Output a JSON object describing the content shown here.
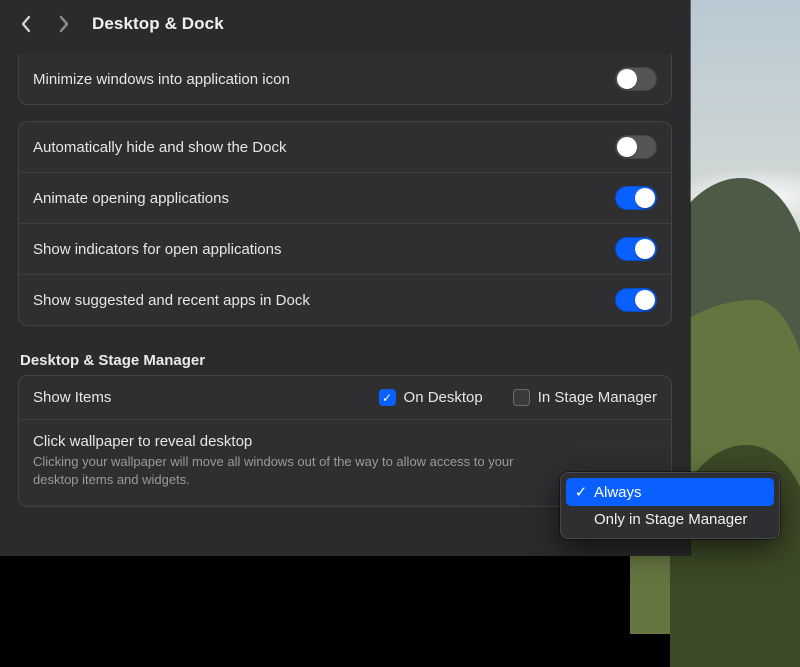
{
  "title": "Desktop & Dock",
  "dock_panel": {
    "minimize_into_icon": {
      "label": "Minimize windows into application icon",
      "on": false
    },
    "auto_hide": {
      "label": "Automatically hide and show the Dock",
      "on": false
    },
    "animate_open": {
      "label": "Animate opening applications",
      "on": true
    },
    "show_indicators": {
      "label": "Show indicators for open applications",
      "on": true
    },
    "show_recents": {
      "label": "Show suggested and recent apps in Dock",
      "on": true
    }
  },
  "stage_section_title": "Desktop & Stage Manager",
  "show_items": {
    "label": "Show Items",
    "on_desktop": {
      "label": "On Desktop",
      "checked": true
    },
    "in_stage_manager": {
      "label": "In Stage Manager",
      "checked": false
    }
  },
  "click_wallpaper": {
    "label": "Click wallpaper to reveal desktop",
    "desc": "Clicking your wallpaper will move all windows out of the way to allow access to your desktop items and widgets."
  },
  "menu": {
    "options": [
      "Always",
      "Only in Stage Manager"
    ],
    "selected_index": 0
  }
}
